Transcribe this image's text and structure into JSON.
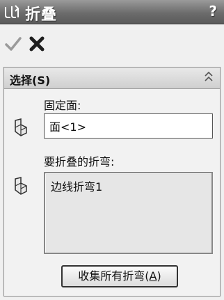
{
  "window": {
    "title": "折叠",
    "help_label": "?"
  },
  "toolbar": {
    "ok_label": "✓",
    "cancel_label": "✕"
  },
  "selection_group": {
    "title": "选择(S)",
    "fixed_face_label": "固定面:",
    "fixed_face_value": "面<1>",
    "bends_label": "要折叠的折弯:",
    "bends_items": [
      "边线折弯1"
    ],
    "collect_button_label": "收集所有折弯(",
    "collect_button_mnemonic": "A",
    "collect_button_suffix": ")"
  }
}
